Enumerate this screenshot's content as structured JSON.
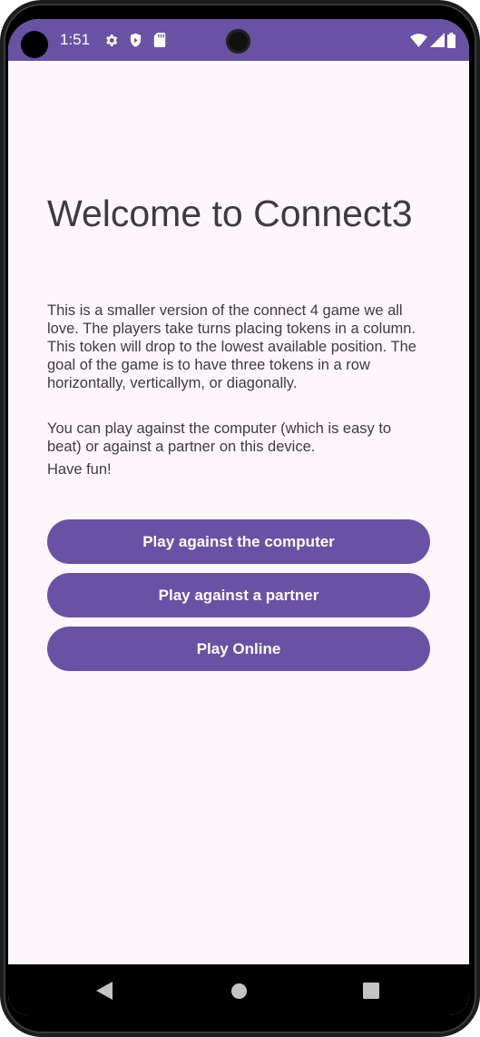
{
  "status_bar": {
    "time": "1:51",
    "bg_color": "#6951a4",
    "left_icons": [
      "settings-icon",
      "shield-icon",
      "sd-card-icon"
    ],
    "right_icons": [
      "wifi-icon",
      "signal-icon",
      "battery-icon"
    ]
  },
  "main": {
    "title": "Welcome to Connect3",
    "paragraph1": "This is a smaller version of the connect 4 game we all love. The players  take turns placing tokens in a column. This token will drop to the lowest available position. The goal of the game is to have three tokens in a row horizontally, verticallym, or diagonally.",
    "paragraph2": "You can play against the computer (which is easy to beat) or against a partner on this device.",
    "paragraph3": "Have fun!",
    "buttons": [
      {
        "label": "Play against the computer"
      },
      {
        "label": "Play against a partner"
      },
      {
        "label": "Play Online"
      }
    ],
    "accent_color": "#6951a4",
    "background_color": "#fdf7fd"
  },
  "nav_bar": {
    "icons": [
      "back-icon",
      "home-icon",
      "recents-icon"
    ]
  }
}
